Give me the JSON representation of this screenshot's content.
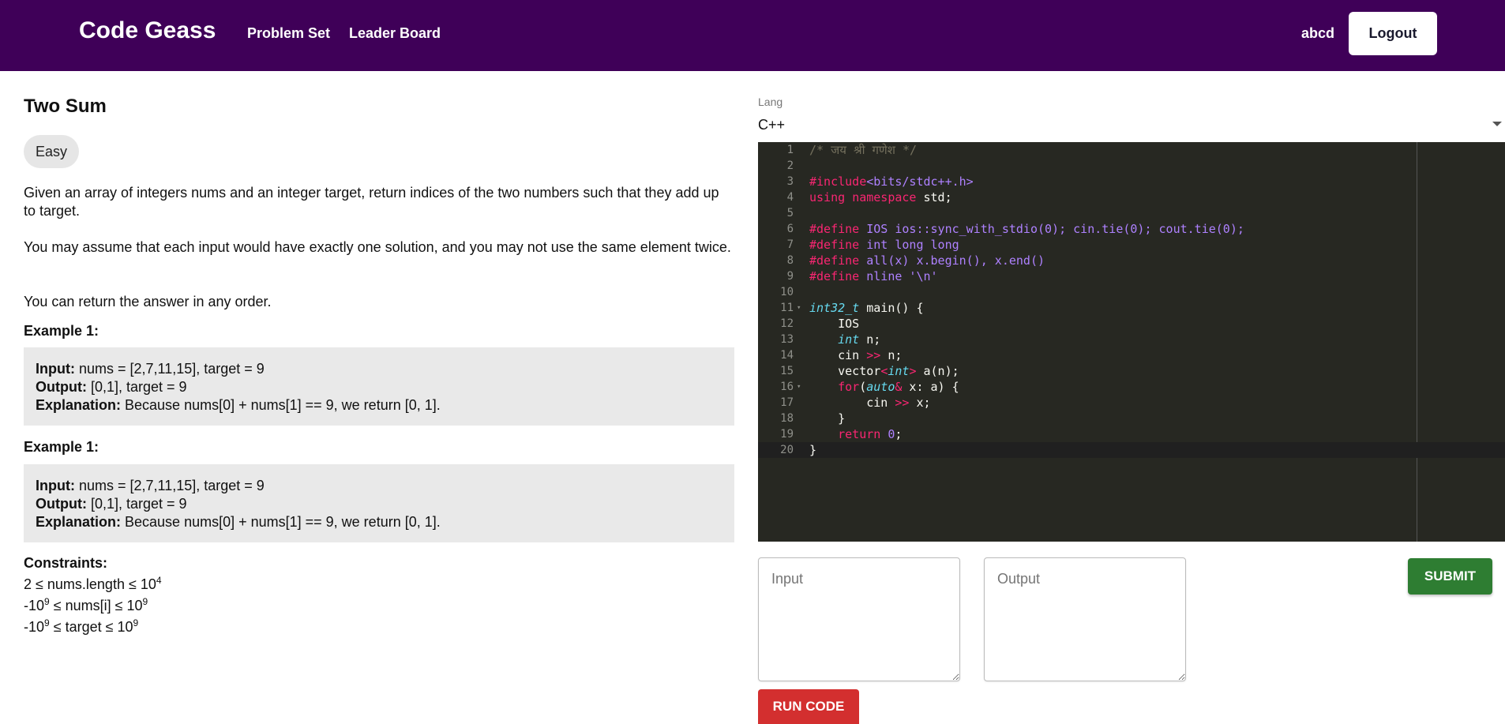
{
  "navbar": {
    "brand": "Code Geass",
    "links": [
      "Problem Set",
      "Leader Board"
    ],
    "username": "abcd",
    "logout_label": "Logout"
  },
  "problem": {
    "title": "Two Sum",
    "difficulty": "Easy",
    "paragraphs": [
      "Given an array of integers nums and an integer target, return indices of the two numbers such that they add up to target.",
      "You may assume that each input would have exactly one solution, and you may not use the same element twice.",
      "You can return the answer in any order."
    ],
    "examples": [
      {
        "title": "Example 1:",
        "input_label": "Input:",
        "input": " nums = [2,7,11,15], target = 9",
        "output_label": "Output:",
        "output": " [0,1], target = 9",
        "explanation_label": "Explanation:",
        "explanation": " Because nums[0] + nums[1] == 9, we return [0, 1]."
      },
      {
        "title": "Example 1:",
        "input_label": "Input:",
        "input": " nums = [2,7,11,15], target = 9",
        "output_label": "Output:",
        "output": " [0,1], target = 9",
        "explanation_label": "Explanation:",
        "explanation": " Because nums[0] + nums[1] == 9, we return [0, 1]."
      }
    ],
    "constraints_title": "Constraints:",
    "constraints": [
      {
        "pre": "2 ≤ nums.length ≤ 10",
        "sup": "4"
      },
      {
        "pre": "-10",
        "sup1": "9",
        "mid": " ≤ nums[i] ≤ 10",
        "sup2": "9"
      },
      {
        "pre": "-10",
        "sup1": "9",
        "mid": " ≤ target ≤ 10",
        "sup2": "9"
      }
    ]
  },
  "editor": {
    "lang_label": "Lang",
    "lang_value": "C++",
    "line_numbers": [
      "1",
      "2",
      "3",
      "4",
      "5",
      "6",
      "7",
      "8",
      "9",
      "10",
      "11",
      "12",
      "13",
      "14",
      "15",
      "16",
      "17",
      "18",
      "19",
      "20"
    ]
  },
  "io": {
    "input_placeholder": "Input",
    "output_placeholder": "Output"
  },
  "buttons": {
    "submit": "SUBMIT",
    "run": "RUN CODE"
  },
  "colors": {
    "navbar": "#3f0058",
    "submit": "#2e7d32",
    "run": "#d32f2f",
    "editor_bg": "#272822"
  }
}
